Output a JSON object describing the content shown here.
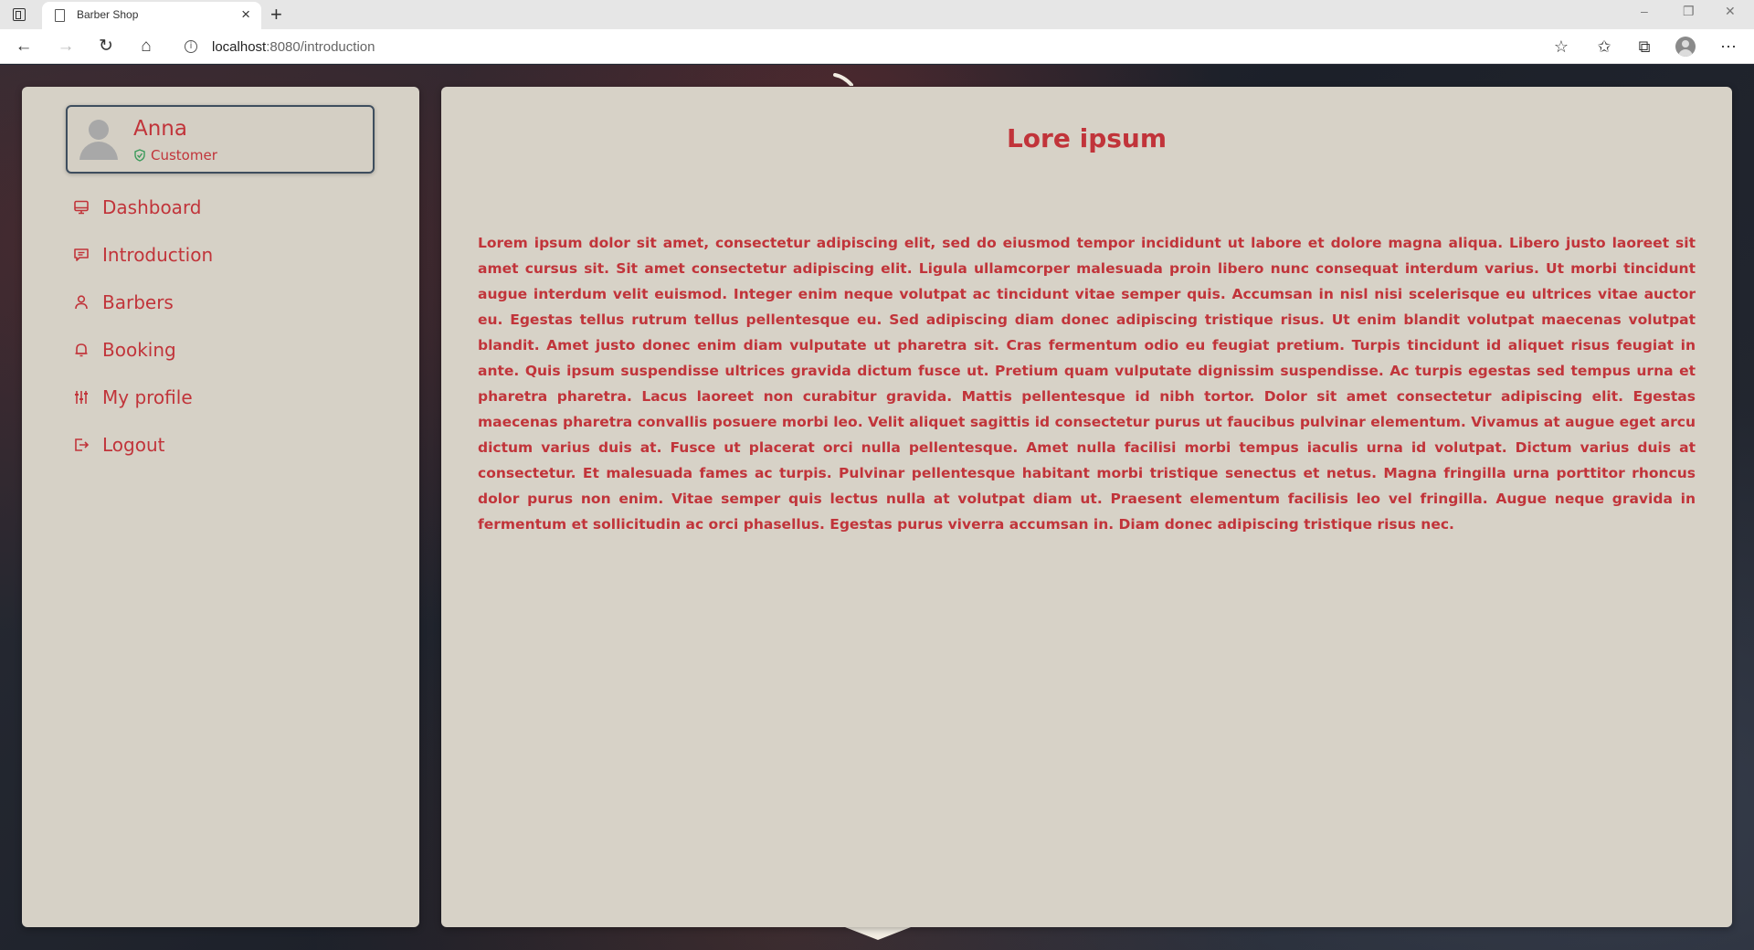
{
  "browser": {
    "tab_title": "Barber Shop",
    "tab_close": "×",
    "new_tab": "+",
    "url_host": "localhost",
    "url_rest": ":8080/introduction",
    "window_controls": [
      "–",
      "❐",
      "✕"
    ],
    "nav_icons": {
      "back": "←",
      "forward": "→",
      "refresh": "↻",
      "home": "⌂"
    },
    "toolbar_icons": {
      "favorite_add": "☆",
      "favorites": "✩",
      "collections": "⧉",
      "more": "⋯"
    },
    "info_glyph": "i"
  },
  "sidebar": {
    "user": {
      "name": "Anna",
      "role": "Customer"
    },
    "items": [
      {
        "label": "Dashboard",
        "icon": "monitor-icon"
      },
      {
        "label": "Introduction",
        "icon": "message-icon"
      },
      {
        "label": "Barbers",
        "icon": "person-icon"
      },
      {
        "label": "Booking",
        "icon": "bell-icon"
      },
      {
        "label": "My profile",
        "icon": "sliders-icon"
      },
      {
        "label": "Logout",
        "icon": "logout-icon"
      }
    ]
  },
  "main": {
    "title": "Lore ipsum",
    "body": "Lorem ipsum dolor sit amet, consectetur adipiscing elit, sed do eiusmod tempor incididunt ut labore et dolore magna aliqua. Libero justo laoreet sit amet cursus sit. Sit amet consectetur adipiscing elit. Ligula ullamcorper malesuada proin libero nunc consequat interdum varius. Ut morbi tincidunt augue interdum velit euismod. Integer enim neque volutpat ac tincidunt vitae semper quis. Accumsan in nisl nisi scelerisque eu ultrices vitae auctor eu. Egestas tellus rutrum tellus pellentesque eu. Sed adipiscing diam donec adipiscing tristique risus. Ut enim blandit volutpat maecenas volutpat blandit. Amet justo donec enim diam vulputate ut pharetra sit. Cras fermentum odio eu feugiat pretium. Turpis tincidunt id aliquet risus feugiat in ante. Quis ipsum suspendisse ultrices gravida dictum fusce ut. Pretium quam vulputate dignissim suspendisse. Ac turpis egestas sed tempus urna et pharetra pharetra. Lacus laoreet non curabitur gravida. Mattis pellentesque id nibh tortor. Dolor sit amet consectetur adipiscing elit. Egestas maecenas pharetra convallis posuere morbi leo. Velit aliquet sagittis id consectetur purus ut faucibus pulvinar elementum. Vivamus at augue eget arcu dictum varius duis at. Fusce ut placerat orci nulla pellentesque. Amet nulla facilisi morbi tempus iaculis urna id volutpat. Dictum varius duis at consectetur. Et malesuada fames ac turpis. Pulvinar pellentesque habitant morbi tristique senectus et netus. Magna fringilla urna porttitor rhoncus dolor purus non enim. Vitae semper quis lectus nulla at volutpat diam ut. Praesent elementum facilisis leo vel fringilla. Augue neque gravida in fermentum et sollicitudin ac orci phasellus. Egestas purus viverra accumsan in. Diam donec adipiscing tristique risus nec."
  },
  "colors": {
    "accent": "#c1343a",
    "panel": "#d7d2c7",
    "user_card_border": "#3f4e5e",
    "role_shield": "#3a9a5a"
  }
}
